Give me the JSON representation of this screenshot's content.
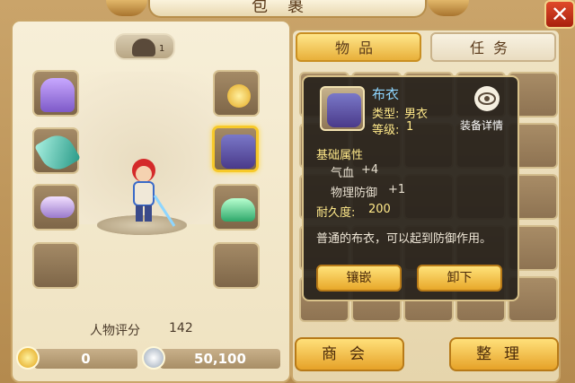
{
  "window": {
    "title": "包裹",
    "close_label": "✕"
  },
  "character": {
    "hat_tab_count": "1",
    "score_label": "人物评分",
    "score_value": "142",
    "equipment_slots": [
      {
        "slot": "head",
        "item": "purple-hat"
      },
      {
        "slot": "necklace",
        "item": "gold-pendant"
      },
      {
        "slot": "weapon",
        "item": "jade-sword"
      },
      {
        "slot": "armor",
        "item": "purple-armor",
        "selected": true
      },
      {
        "slot": "belt",
        "item": "purple-belt"
      },
      {
        "slot": "shoes",
        "item": "green-shoes"
      },
      {
        "slot": "empty-left",
        "item": ""
      },
      {
        "slot": "empty-right",
        "item": ""
      }
    ]
  },
  "currency": {
    "gold": "0",
    "silver": "50,100"
  },
  "tabs": [
    {
      "label": "物品",
      "active": true
    },
    {
      "label": "任务",
      "active": false
    }
  ],
  "bottom_buttons": {
    "shop": "商会",
    "sort": "整理"
  },
  "tooltip": {
    "name": "布衣",
    "type_label": "类型:",
    "type_value": "男衣",
    "level_label": "等级:",
    "level_value": "1",
    "details_label": "装备详情",
    "base_attr_title": "基础属性",
    "attrs": [
      {
        "name": "气血",
        "value": "+4"
      },
      {
        "name": "物理防御",
        "value": "+1"
      }
    ],
    "durability_label": "耐久度:",
    "durability_value": "200",
    "description": "普通的布衣，可以起到防御作用。",
    "inlay_button": "镶嵌",
    "unequip_button": "卸下"
  },
  "colors": {
    "accent": "#f7c92a",
    "tooltip_name": "#8ed6ff",
    "tooltip_label": "#ffe98a"
  }
}
